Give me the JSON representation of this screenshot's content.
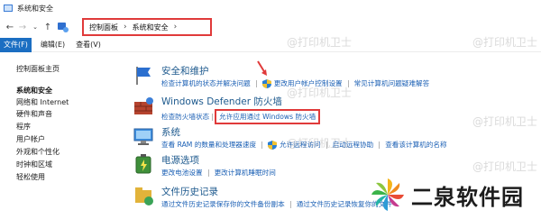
{
  "window": {
    "title": "系统和安全"
  },
  "address": {
    "crumbs": [
      "控制面板",
      "系统和安全"
    ]
  },
  "menu": [
    "文件(F)",
    "编辑(E)",
    "查看(V)"
  ],
  "sidebar": {
    "items": [
      "控制面板主页",
      "系统和安全",
      "网络和 Internet",
      "硬件和声音",
      "程序",
      "用户帐户",
      "外观和个性化",
      "时钟和区域",
      "轻松使用"
    ]
  },
  "sections": [
    {
      "title": "安全和维护",
      "icon": "flag-icon",
      "links": [
        "检查计算机的状态并解决问题",
        "更改用户帐户控制设置",
        "常见计算机问题疑难解答"
      ]
    },
    {
      "title": "Windows Defender 防火墙",
      "icon": "firewall-icon",
      "links": [
        "检查防火墙状态",
        "允许应用通过 Windows 防火墙"
      ]
    },
    {
      "title": "系统",
      "icon": "monitor-icon",
      "links": [
        "查看 RAM 的数量和处理器速度",
        "允许远程访问",
        "启动远程协助",
        "查看该计算机的名称"
      ]
    },
    {
      "title": "电源选项",
      "icon": "battery-icon",
      "links": [
        "更改电池设置",
        "更改计算机睡眠时间"
      ]
    },
    {
      "title": "文件历史记录",
      "icon": "file-history-icon",
      "links": [
        "通过文件历史记录保存你的文件备份副本",
        "通过文件历史记录恢复你的文件"
      ]
    }
  ],
  "watermark": "@打印机卫士",
  "brand": {
    "name": "二泉软件园"
  },
  "colors": {
    "highlight": "#e03a3a",
    "link": "#1a5fb4",
    "title": "#1e5a8e",
    "menu_active": "#1b6ec2"
  }
}
